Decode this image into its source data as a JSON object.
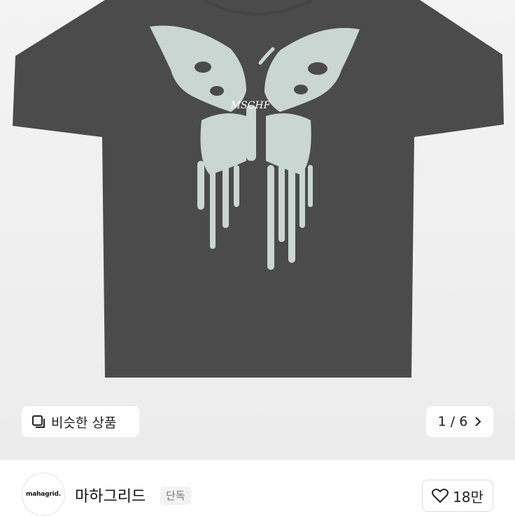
{
  "product": {
    "image_alt": "dark gray t-shirt with dripping butterfly print",
    "print_text": "MSCHF"
  },
  "similar_button": {
    "label": "비슷한 상품",
    "icon": "similar-products-icon"
  },
  "pager": {
    "current": "1",
    "separator": "/",
    "total": "6",
    "icon": "chevron-right-icon"
  },
  "shop": {
    "avatar_text": "mahagrid.",
    "name": "마하그리드",
    "badge": "단독"
  },
  "like": {
    "count": "18만",
    "icon": "heart-outline-icon"
  },
  "colors": {
    "shirt": "#4b4b4b",
    "print": "#c9d6d2",
    "background": "#efefef"
  }
}
